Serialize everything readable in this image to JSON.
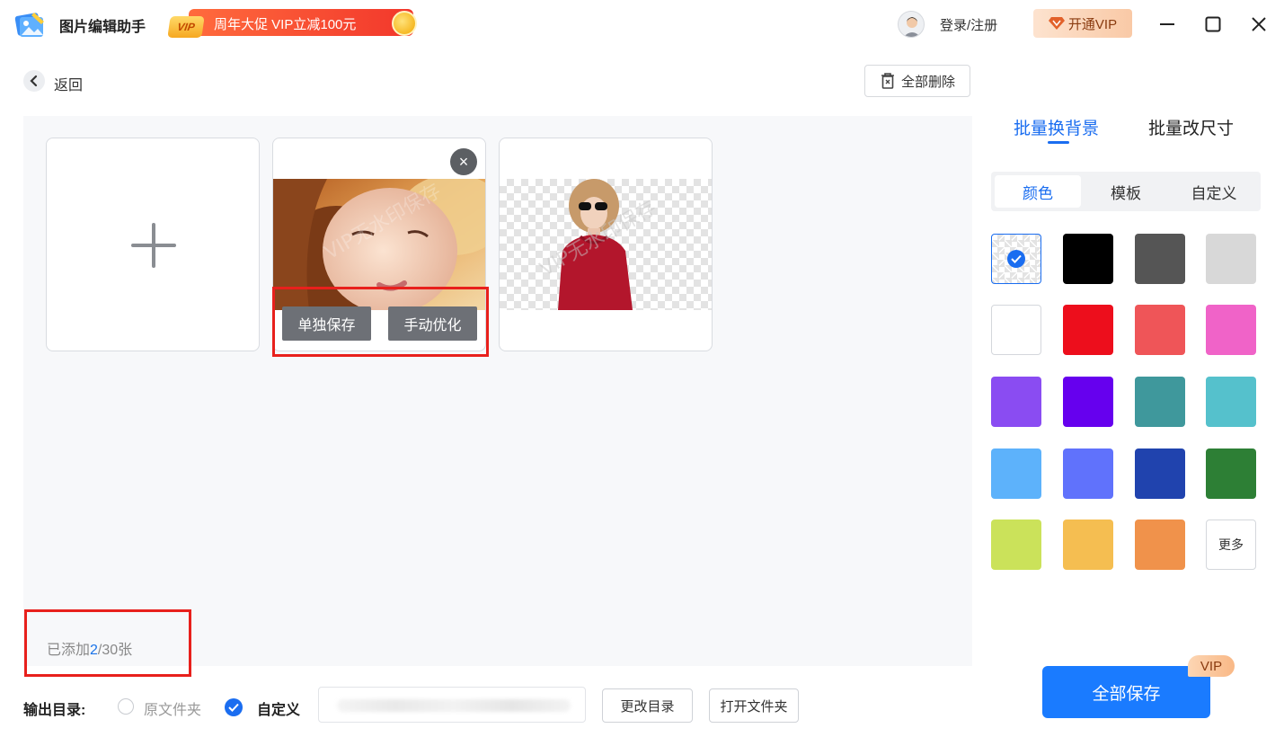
{
  "titlebar": {
    "app_title": "图片编辑助手",
    "promo_badge": "VIP",
    "promo_text": "周年大促 VIP立减100元",
    "login": "登录/注册",
    "open_vip": "开通VIP"
  },
  "toolbar": {
    "back": "返回",
    "delete_all": "全部删除"
  },
  "cards": {
    "save_single": "单独保存",
    "manual_optimize": "手动优化",
    "close_symbol": "×"
  },
  "canvas": {
    "added_prefix": "已添加",
    "added_count": "2",
    "added_suffix": "/30张"
  },
  "output": {
    "label": "输出目录:",
    "option_original": "原文件夹",
    "option_custom": "自定义",
    "change_dir": "更改目录",
    "open_folder": "打开文件夹"
  },
  "panel": {
    "tab_bg": "批量换背景",
    "tab_size": "批量改尺寸",
    "seg_color": "颜色",
    "seg_template": "模板",
    "seg_custom": "自定义",
    "more": "更多",
    "selected_swatch": "transparent",
    "swatches": [
      "transparent",
      "#000000",
      "#555555",
      "#d8d8d8",
      "#ffffff",
      "#ed0e1c",
      "#ef5558",
      "#f063c8",
      "#8a4cf2",
      "#6600ee",
      "#3f989c",
      "#55c1cc",
      "#5db2fb",
      "#6072fc",
      "#2043ae",
      "#2d7f35",
      "#cbe25a",
      "#f5be51",
      "#f0924b",
      "more"
    ]
  },
  "save_all": "全部保存",
  "save_all_badge": "VIP",
  "colors": {
    "accent": "#1a6df0",
    "primary_button": "#1a7bff",
    "highlight_box": "#e8201c"
  }
}
